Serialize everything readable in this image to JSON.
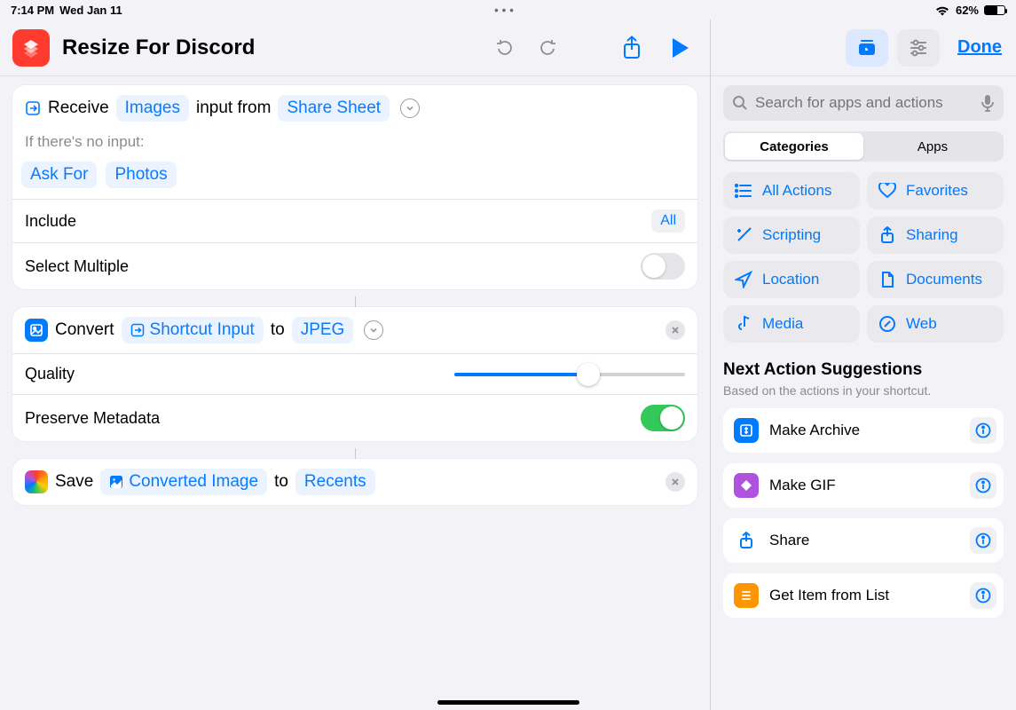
{
  "status": {
    "time": "7:14 PM",
    "date": "Wed Jan 11",
    "battery_pct": "62%"
  },
  "header": {
    "title": "Resize For Discord"
  },
  "sidebar_header": {
    "done": "Done"
  },
  "action1": {
    "receive": "Receive",
    "types": "Images",
    "input_from": "input from",
    "source": "Share Sheet",
    "no_input_label": "If there's no input:",
    "fallback1": "Ask For",
    "fallback2": "Photos",
    "include_label": "Include",
    "include_value": "All",
    "select_multiple": "Select Multiple",
    "quality_slider_fraction": 0.58
  },
  "action2": {
    "verb": "Convert",
    "input": "Shortcut Input",
    "to": "to",
    "format": "JPEG",
    "quality_label": "Quality",
    "preserve_label": "Preserve Metadata"
  },
  "action3": {
    "verb": "Save",
    "input": "Converted Image",
    "to": "to",
    "dest": "Recents"
  },
  "search": {
    "placeholder": "Search for apps and actions"
  },
  "seg": {
    "a": "Categories",
    "b": "Apps"
  },
  "categories": {
    "all": "All Actions",
    "fav": "Favorites",
    "scr": "Scripting",
    "shr": "Sharing",
    "loc": "Location",
    "doc": "Documents",
    "med": "Media",
    "web": "Web"
  },
  "suggestions": {
    "heading": "Next Action Suggestions",
    "sub": "Based on the actions in your shortcut.",
    "items": [
      "Make Archive",
      "Make GIF",
      "Share",
      "Get Item from List"
    ]
  }
}
